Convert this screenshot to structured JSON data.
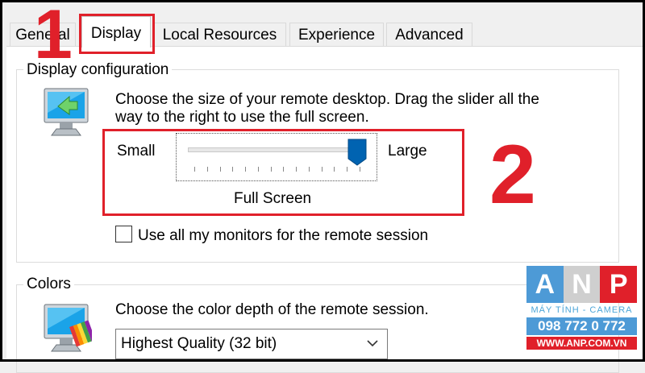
{
  "tabs": [
    {
      "label": "General",
      "active": false
    },
    {
      "label": "Display",
      "active": true
    },
    {
      "label": "Local Resources",
      "active": false
    },
    {
      "label": "Experience",
      "active": false
    },
    {
      "label": "Advanced",
      "active": false
    }
  ],
  "display_config": {
    "group_label": "Display configuration",
    "description_line1": "Choose the size of your remote desktop. Drag the slider all the",
    "description_line2": "way to the right to use the full screen.",
    "slider": {
      "min_label": "Small",
      "max_label": "Large",
      "value_label": "Full Screen",
      "position_fraction": 1.0,
      "tick_count": 14
    },
    "monitors_checkbox": {
      "label": "Use all my monitors for the remote session",
      "checked": false
    }
  },
  "colors": {
    "group_label": "Colors",
    "description": "Choose the color depth of the remote session.",
    "select_value": "Highest Quality (32 bit)"
  },
  "annotations": {
    "step1": "1",
    "step2": "2"
  },
  "watermark": {
    "letters": [
      "A",
      "N",
      "P"
    ],
    "tagline": "MÁY TÍNH - CAMERA",
    "phone": "098 772 0 772",
    "website": "WWW.ANP.COM.VN"
  },
  "colors_palette": {
    "accent": "#0063b1",
    "annotation_red": "#e0202a",
    "watermark_blue": "#4d9ad6"
  }
}
